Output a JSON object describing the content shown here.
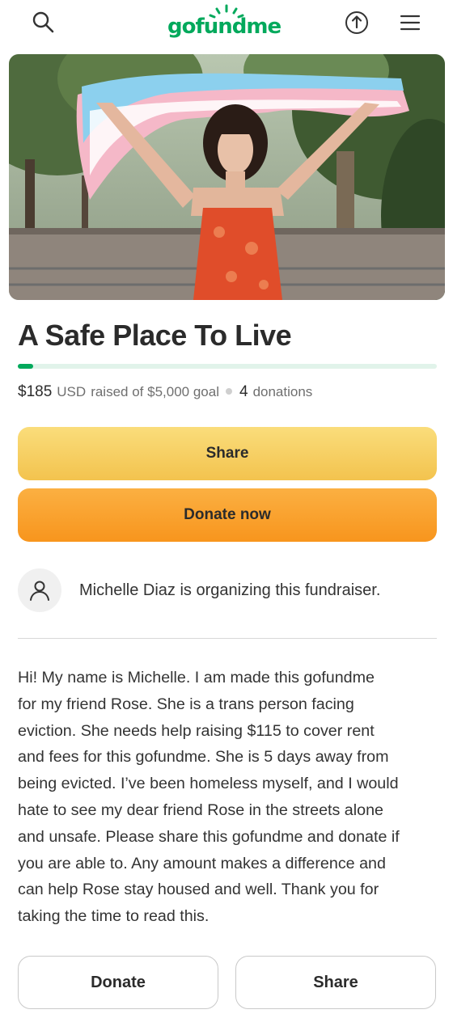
{
  "header": {
    "logo_text": "gofundme",
    "icons": [
      "search-icon",
      "share-upload-icon",
      "hamburger-menu-icon"
    ]
  },
  "campaign": {
    "title": "A Safe Place To Live",
    "raised_amount": "$185",
    "currency": "USD",
    "goal_text": "raised of $5,000 goal",
    "donation_count": "4",
    "donations_label": "donations",
    "progress_fraction": 0.037
  },
  "actions": {
    "share_label": "Share",
    "donate_now_label": "Donate now"
  },
  "organizer": {
    "text": "Michelle Diaz is organizing this fundraiser."
  },
  "story": {
    "lines": [
      "Hi! My name is Michelle. I am made this gofundme",
      "for my friend Rose. She is a trans person facing",
      "eviction. She needs help raising $115 to cover rent",
      "and fees for this gofundme. She is 5 days away from",
      "being evicted. I’ve been homeless myself, and I would",
      "hate to see my dear friend Rose in the streets alone",
      "and unsafe. Please share this gofundme and donate if",
      "you are able to. Any amount makes a difference and",
      "can help Rose stay housed and well. Thank you for",
      "taking the time to read this."
    ]
  },
  "footer": {
    "donate_label": "Donate",
    "share_label": "Share"
  },
  "colors": {
    "brand_green": "#02a95c",
    "share_yellow": "#f5c94f",
    "donate_orange": "#f9a12c"
  }
}
